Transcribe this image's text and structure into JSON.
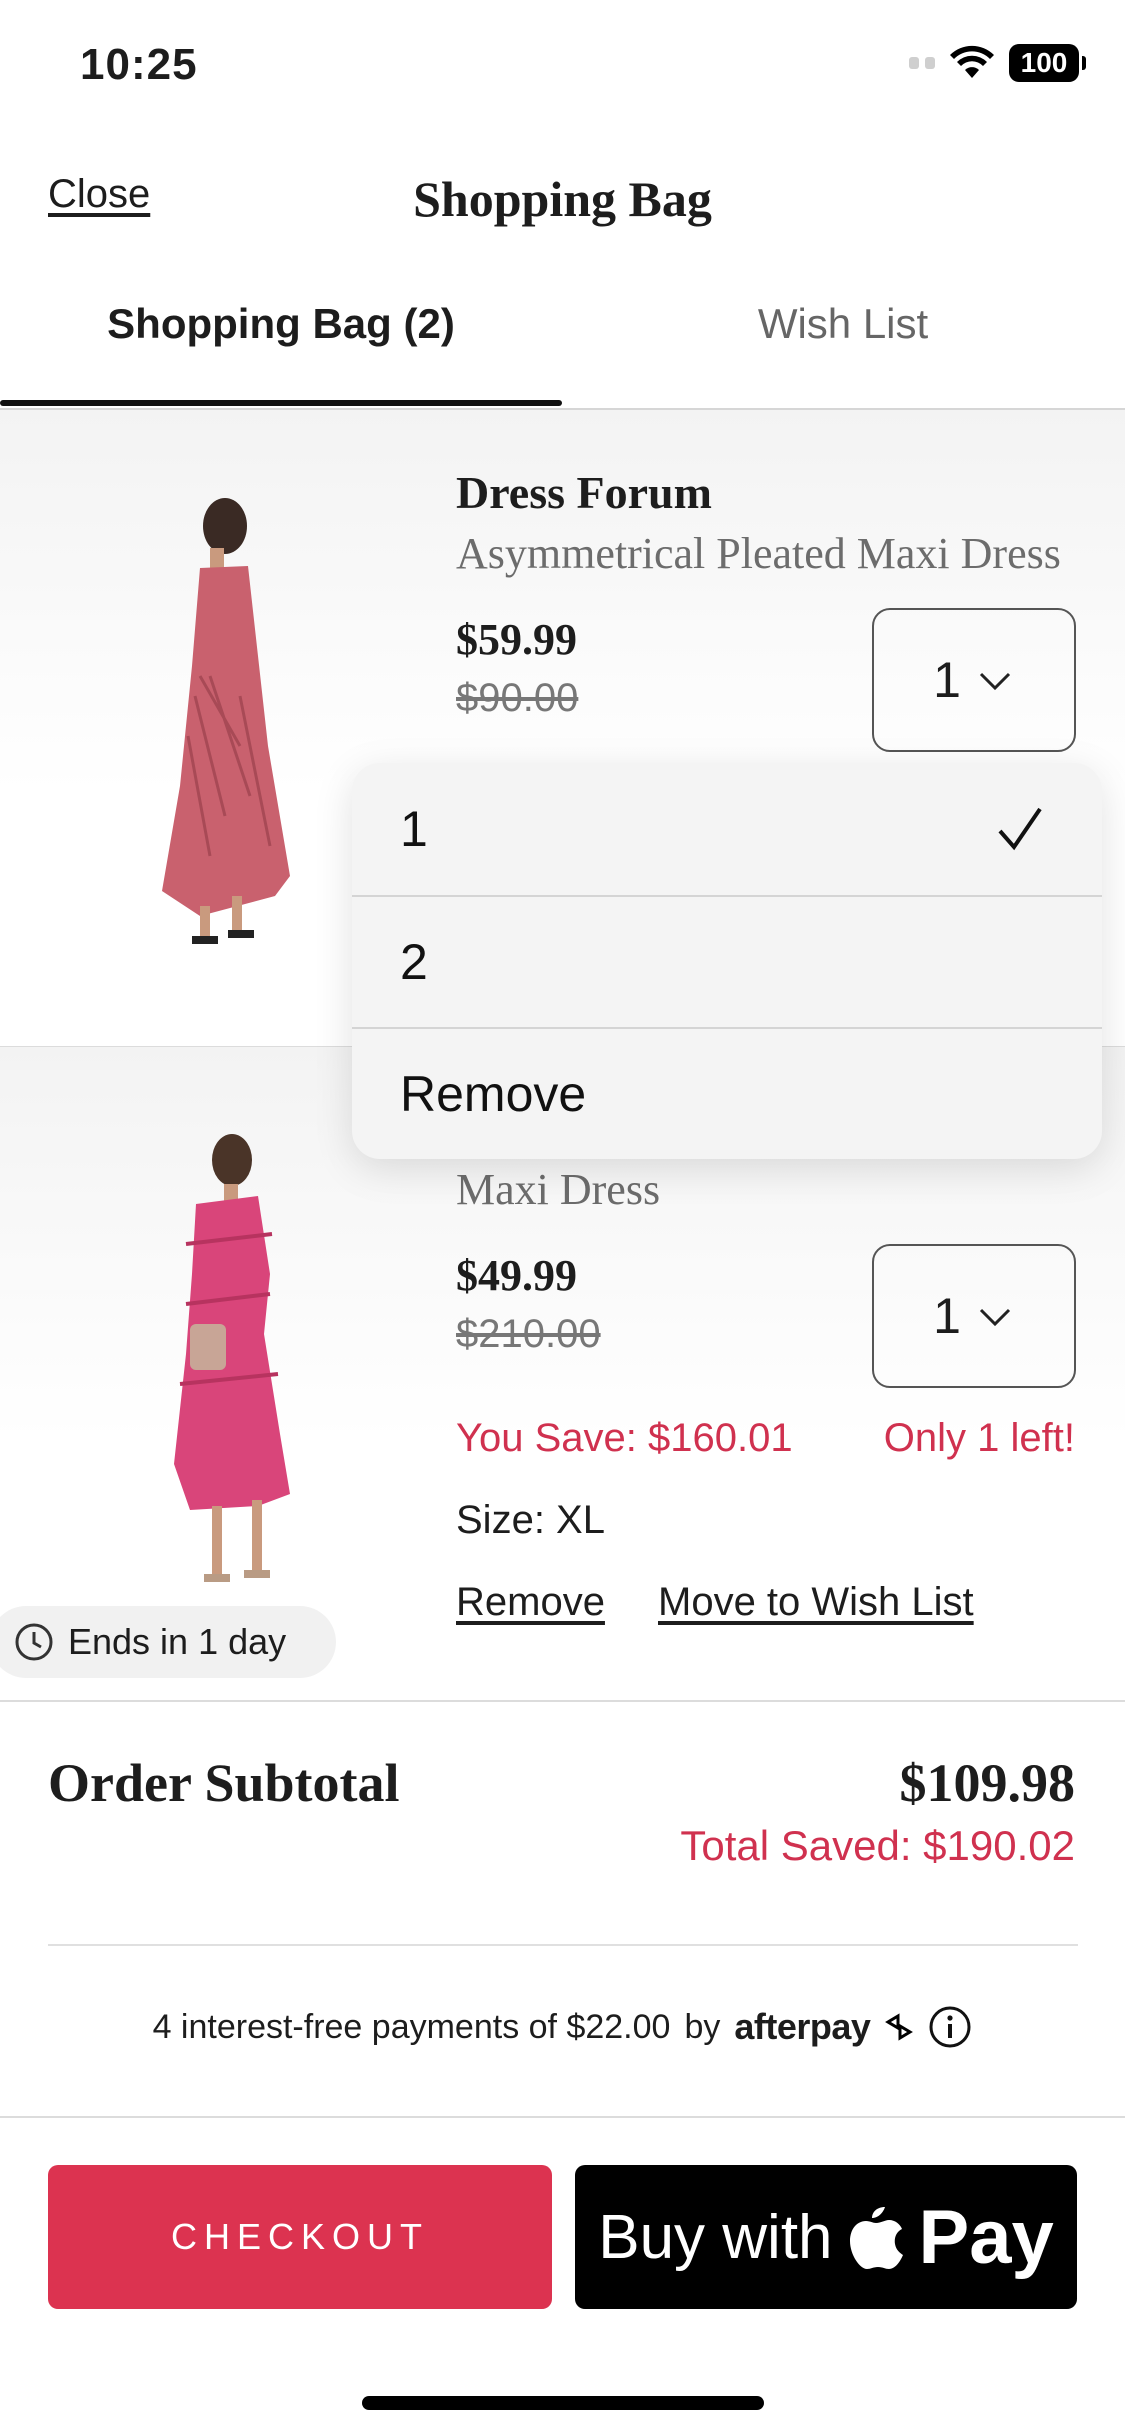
{
  "status_bar": {
    "time": "10:25",
    "battery": "100"
  },
  "header": {
    "close_label": "Close",
    "title": "Shopping Bag"
  },
  "tabs": [
    {
      "label": "Shopping Bag (2)",
      "active": true
    },
    {
      "label": "Wish List",
      "active": false
    }
  ],
  "items": [
    {
      "brand": "Dress Forum",
      "name": "Asymmetrical Pleated Maxi Dress",
      "price": "$59.99",
      "original_price": "$90.00",
      "quantity": "1",
      "image_color": "#c9616e"
    },
    {
      "name_visible": "Maxi Dress",
      "price": "$49.99",
      "original_price": "$210.00",
      "quantity": "1",
      "you_save": "You Save: $160.01",
      "stock_note": "Only 1 left!",
      "size": "Size: XL",
      "remove_label": "Remove",
      "move_label": "Move to Wish List",
      "timer": "Ends in 1 day",
      "image_color": "#d9457a"
    }
  ],
  "quantity_dropdown": {
    "options": [
      "1",
      "2",
      "Remove"
    ],
    "selected": "1"
  },
  "summary": {
    "subtotal_label": "Order Subtotal",
    "subtotal_value": "$109.98",
    "total_saved": "Total Saved: $190.02"
  },
  "afterpay": {
    "text": "4 interest-free payments of $22.00",
    "by": "by",
    "brand": "afterpay"
  },
  "actions": {
    "checkout_label": "CHECKOUT",
    "applepay_prefix": "Buy with",
    "applepay_suffix": "Pay"
  },
  "colors": {
    "accent": "#dc3350",
    "sale_red": "#d0314f"
  }
}
